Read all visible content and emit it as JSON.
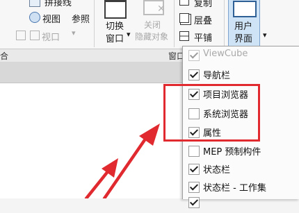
{
  "ribbon": {
    "window_group": {
      "tile_label": "拼接线",
      "view_label": "视图",
      "ref_label": "参照",
      "viewport_label": "视口"
    },
    "switch_window": {
      "line1": "切换",
      "line2": "窗口"
    },
    "close_hidden": {
      "line1": "关闭",
      "line2": "隐藏对象"
    },
    "copy_label": "复制",
    "cascade_label": "层叠",
    "tile_label": "平铺",
    "user_interface": {
      "line1": "用户",
      "line2": "界面"
    },
    "panel_left_label": "合",
    "panel_window_label": "窗口"
  },
  "menu": {
    "items": [
      {
        "label": "ViewCube",
        "checked": true,
        "enabled": false
      },
      {
        "label": "导航栏",
        "checked": true,
        "enabled": true
      },
      {
        "label": "项目浏览器",
        "checked": true,
        "enabled": true
      },
      {
        "label": "系统浏览器",
        "checked": false,
        "enabled": true
      },
      {
        "label": "属性",
        "checked": true,
        "enabled": true
      },
      {
        "label": "MEP 预制构件",
        "checked": false,
        "enabled": true
      },
      {
        "label": "状态栏",
        "checked": true,
        "enabled": true
      },
      {
        "label": "状态栏 - 工作集",
        "checked": true,
        "enabled": true
      },
      {
        "label": "",
        "checked": true,
        "enabled": true
      }
    ]
  },
  "annotation": {
    "highlight_color": "#e02a2f"
  }
}
